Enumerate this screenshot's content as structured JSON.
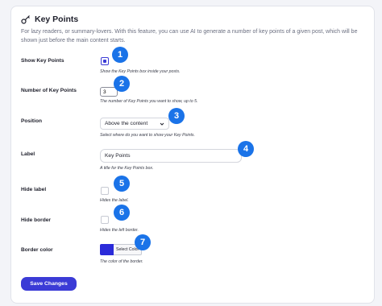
{
  "header": {
    "title": "Key Points",
    "description": "For lazy readers, or summary-lovers. With this feature, you can use AI to generate a number of key points of a given post, which will be shown just before the main content starts."
  },
  "fields": {
    "show": {
      "label": "Show Key Points",
      "help": "Show the Key Points box inside your posts.",
      "checked": true
    },
    "number": {
      "label": "Number of Key Points",
      "value": "3",
      "help": "The number of Key Points you want to show, up to 5."
    },
    "position": {
      "label": "Position",
      "selected": "Above the content",
      "help": "Select where do you want to show your Key Points."
    },
    "label": {
      "label": "Label",
      "value": "Key Points",
      "help": "A title for the Key Points box."
    },
    "hide_label": {
      "label": "Hide label",
      "help": "Hides the label.",
      "checked": false
    },
    "hide_border": {
      "label": "Hide border",
      "help": "Hides the left border.",
      "checked": false
    },
    "border_color": {
      "label": "Border color",
      "button": "Select Color",
      "help": "The color of the border.",
      "color": "#2b2bd9"
    }
  },
  "badges": [
    "1",
    "2",
    "3",
    "4",
    "5",
    "6",
    "7"
  ],
  "save_label": "Save Changes",
  "colors": {
    "accent": "#3b3bd6",
    "badge": "#1a73e8"
  }
}
